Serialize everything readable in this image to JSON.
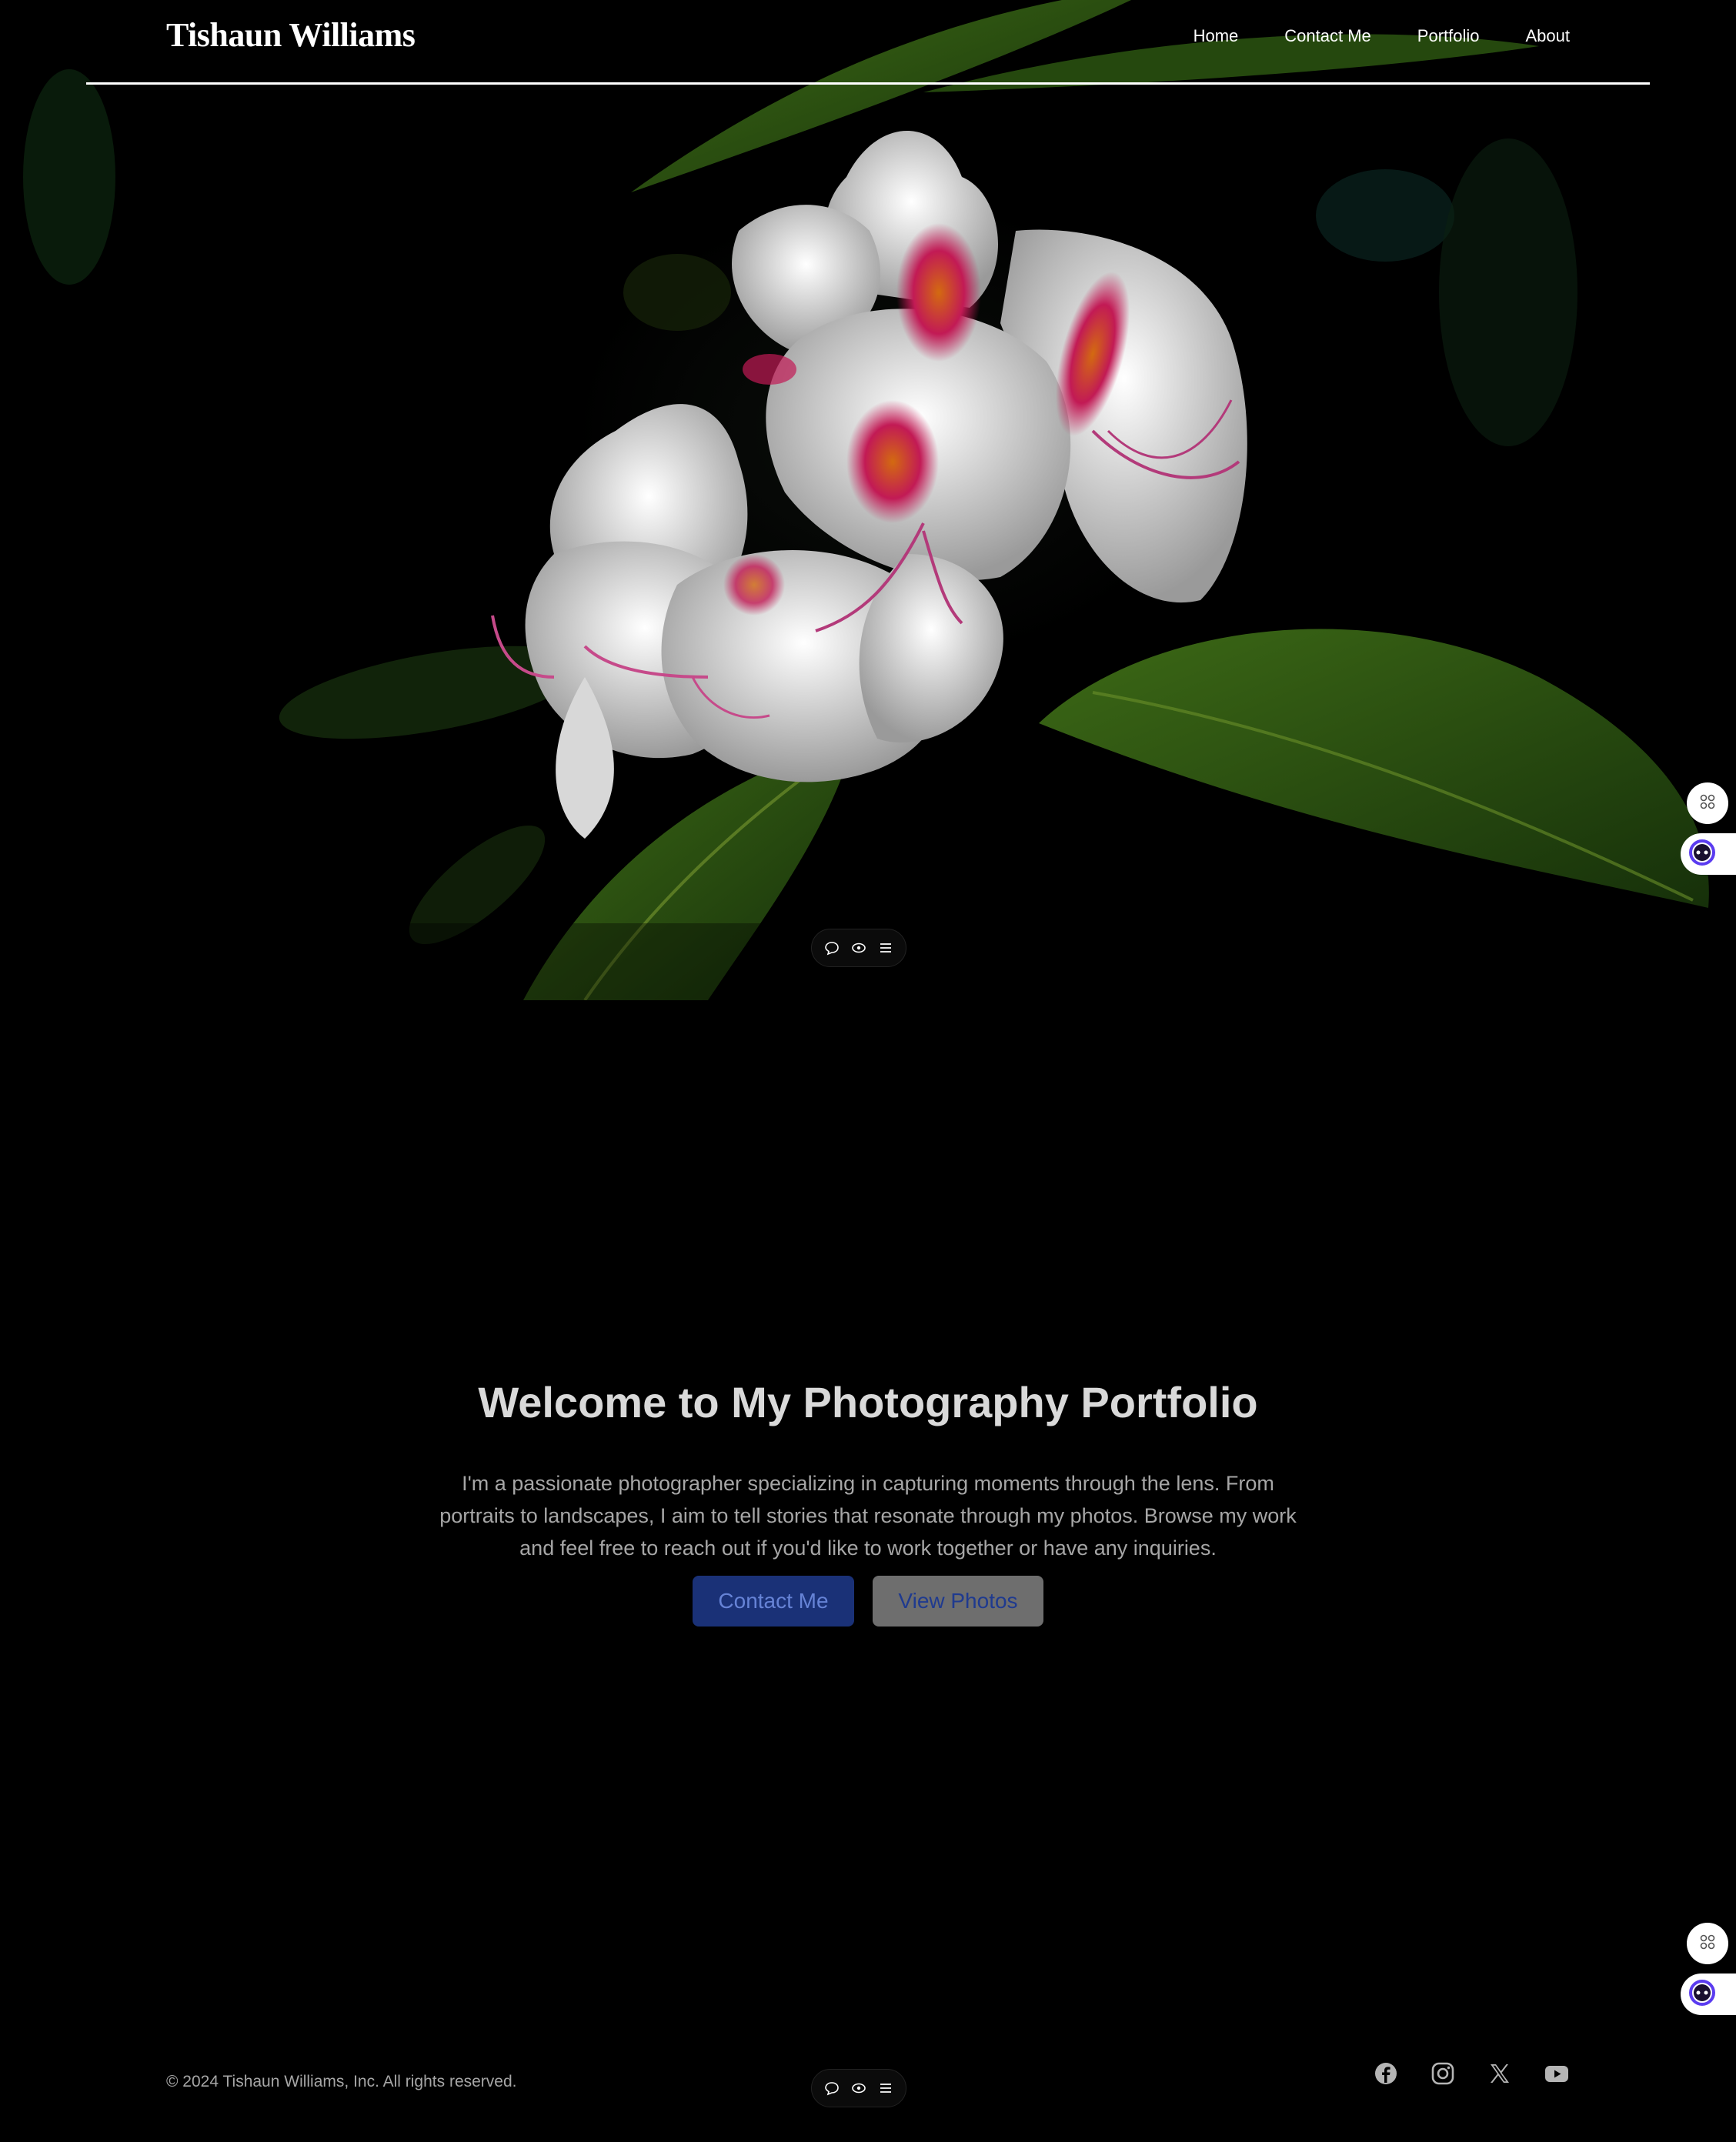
{
  "header": {
    "brand": "Tishaun Williams",
    "nav": [
      "Home",
      "Contact Me",
      "Portfolio",
      "About"
    ]
  },
  "hero": {
    "image": "white rhododendron flower with green leaves on black background"
  },
  "intro": {
    "title": "Welcome to My Photography Portfolio",
    "body": "I'm a passionate photographer specializing in capturing moments through the lens. From portraits to landscapes, I aim to tell stories that resonate through my photos. Browse my work and feel free to reach out if you'd like to work together or have any inquiries.",
    "primary_button": "Contact Me",
    "secondary_button": "View Photos"
  },
  "footer": {
    "copyright": "© 2024 Tishaun Williams, Inc. All rights reserved.",
    "socials": [
      "facebook-icon",
      "instagram-icon",
      "x-icon",
      "youtube-icon"
    ]
  },
  "tools": [
    "comment-icon",
    "eye-icon",
    "menu-icon"
  ],
  "colors": {
    "primary_button_bg": "#1a3177",
    "secondary_button_bg": "#6e6e6e"
  }
}
